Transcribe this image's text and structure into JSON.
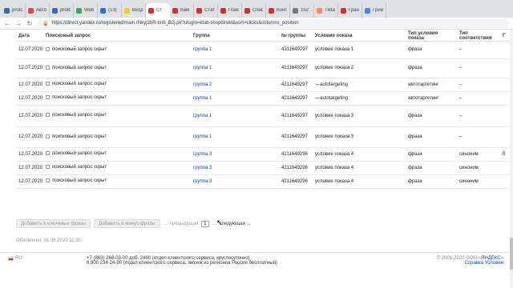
{
  "tabs": [
    {
      "label": "protc",
      "color": "#2f6db5",
      "active": false
    },
    {
      "label": "Авто",
      "color": "#e8453c",
      "active": false
    },
    {
      "label": "protc",
      "color": "#2f6db5",
      "active": false
    },
    {
      "label": "Web",
      "color": "#34a853",
      "active": false
    },
    {
      "label": "(13)",
      "color": "#1877f2",
      "active": false
    },
    {
      "label": "Вход",
      "color": "#ffcc00",
      "active": false
    },
    {
      "label": "Ст",
      "color": "#d93025",
      "active": true
    },
    {
      "label": "Кам",
      "color": "#d93025",
      "active": false
    },
    {
      "label": "Стати",
      "color": "#d93025",
      "active": false
    },
    {
      "label": "Поис",
      "color": "#d93025",
      "active": false
    },
    {
      "label": "Спасі",
      "color": "#d93025",
      "active": false
    },
    {
      "label": "Конт",
      "color": "#d93025",
      "active": false
    },
    {
      "label": "152",
      "color": "#777777",
      "active": false
    },
    {
      "label": "Tilda",
      "color": "#ff8562",
      "active": false
    },
    {
      "label": "Гран",
      "color": "#d93025",
      "active": false
    },
    {
      "label": "Грим",
      "color": "#4285f4",
      "active": false
    }
  ],
  "url": "https://direct.yandex.ru/registered/main.rNkyj2bR-tmb_B2j.pl/?ulogin=klub-shopdirekt&sort=clicks&columns_position",
  "table": {
    "headers": [
      "Дата",
      "Поисковый запрос",
      "Группа",
      "№ группы",
      "Условие показа",
      "Тип условия показа",
      "Тип соответствия",
      "Г"
    ],
    "rows": [
      {
        "date": "12.07.2020",
        "query": "поисковый запрос скрыт",
        "group": "группа 1",
        "group_id": "4211649297",
        "condition": "условие показа 1",
        "cond_type": "фраза",
        "match": "–",
        "extra": ""
      },
      {
        "date": "12.07.2020",
        "query": "поисковый запрос скрыт",
        "group": "группа 1",
        "group_id": "4211649297",
        "condition": "условие показа 2",
        "cond_type": "фраза",
        "match": "–",
        "extra": ""
      },
      {
        "date": "12.07.2020",
        "query": "поисковый запрос скрыт",
        "group": "группа 2",
        "group_id": "4211649297",
        "condition": "---autotargeting",
        "cond_type": "автотаргетинг",
        "match": "–",
        "extra": ""
      },
      {
        "date": "12.07.2020",
        "query": "поисковый запрос скрыт",
        "group": "группа 1",
        "group_id": "4211649297",
        "condition": "---autotargeting",
        "cond_type": "автотаргетинг",
        "match": "–",
        "extra": ""
      },
      {
        "date": "12.07.2020",
        "query": "поисковый запрос скрыт",
        "group": "группа 1",
        "group_id": "4211649297",
        "condition": "условие показа 3",
        "cond_type": "фраза",
        "match": "–",
        "extra": ""
      },
      {
        "date": "12.07.2020",
        "query": "поисковый запрос скрыт",
        "group": "группа 1",
        "group_id": "4211649297",
        "condition": "условие показа 3",
        "cond_type": "фраза",
        "match": "–",
        "extra": ""
      },
      {
        "date": "12.07.2020",
        "query": "поисковый запрос скрыт",
        "group": "группа 3",
        "group_id": "4211649296",
        "condition": "условие показа 4",
        "cond_type": "фраза",
        "match": "синоним",
        "extra": "б"
      },
      {
        "date": "12.07.2020",
        "query": "поисковый запрос скрыт",
        "group": "группа 3",
        "group_id": "4211649296",
        "condition": "условие показа 4",
        "cond_type": "фраза",
        "match": "синоним",
        "extra": ""
      },
      {
        "date": "12.07.2020",
        "query": "поисковый запрос скрыт",
        "group": "группа 3",
        "group_id": "4211649296",
        "condition": "условие показа 4",
        "cond_type": "фраза",
        "match": "синоним",
        "extra": ""
      }
    ]
  },
  "actions": {
    "add_keywords": "Добавить в ключевые фразы",
    "add_minus": "Добавить в минус-фразы"
  },
  "pager": {
    "prev": "← предыдущая",
    "current": "1",
    "dots": "...",
    "next": "следующая →"
  },
  "updated": "Обновлено: 01.08.2020 11:33",
  "footer": {
    "lang": "RU",
    "phone1": "+7 (863) 268-03-00 доб. 2480 (отдел клиентского сервиса, круглосуточно)",
    "phone2": "8 800 234-24-80 (отдел клиентского сервиса, звонок из регионов России бесплатный)",
    "copyright_prefix": "© 2001-2020 ООО «",
    "company": "ЯНДЕКС",
    "copyright_suffix": "»",
    "help_link": "Справка",
    "offer_link": "Условия"
  }
}
